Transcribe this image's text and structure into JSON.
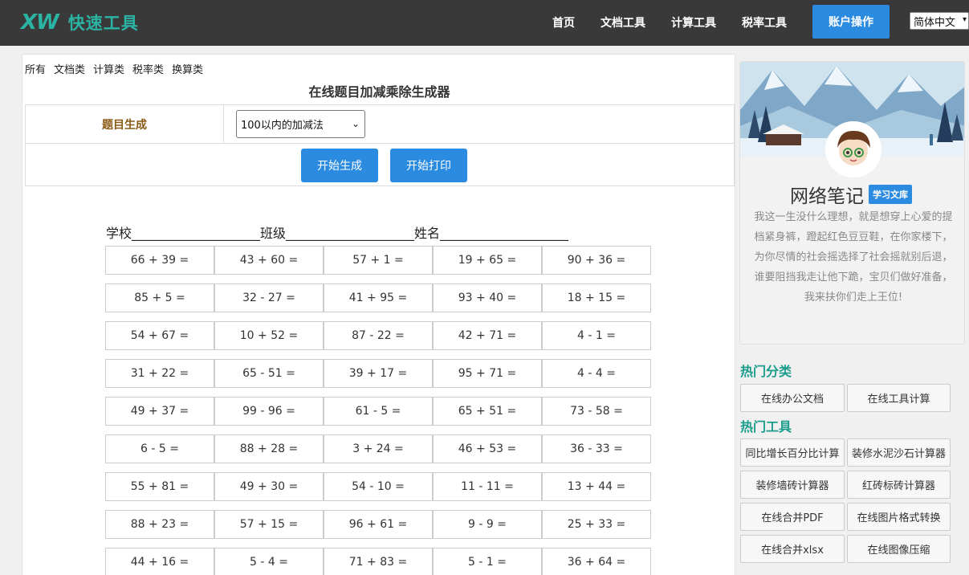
{
  "header": {
    "logo_mark": "XW",
    "logo_text": "快速工具",
    "nav": [
      "首页",
      "文档工具",
      "计算工具",
      "税率工具"
    ],
    "account_button": "账户操作",
    "language": "简体中文"
  },
  "main": {
    "categories": [
      "所有",
      "文档类",
      "计算类",
      "税率类",
      "换算类"
    ],
    "title": "在线题目加减乘除生成器",
    "form": {
      "label": "题目生成",
      "select_value": "100以内的加减法",
      "generate_button": "开始生成",
      "print_button": "开始打印"
    },
    "sheet_header": "学校____________________班级____________________姓名____________________",
    "problems": [
      [
        "66 + 39 =",
        "43 + 60 =",
        "57 + 1 =",
        "19 + 65 =",
        "90 + 36 ="
      ],
      [
        "85 + 5 =",
        "32 - 27 =",
        "41 + 95 =",
        "93 + 40 =",
        "18 + 15 ="
      ],
      [
        "54 + 67 =",
        "10 + 52 =",
        "87 - 22 =",
        "42 + 71 =",
        "4 - 1 ="
      ],
      [
        "31 + 22 =",
        "65 - 51 =",
        "39 + 17 =",
        "95 + 71 =",
        "4 - 4 ="
      ],
      [
        "49 + 37 =",
        "99 - 96 =",
        "61 - 5 =",
        "65 + 51 =",
        "73 - 58 ="
      ],
      [
        "6 - 5 =",
        "88 + 28 =",
        "3 + 24 =",
        "46 + 53 =",
        "36 - 33 ="
      ],
      [
        "55 + 81 =",
        "49 + 30 =",
        "54 - 10 =",
        "11 - 11 =",
        "13 + 44 ="
      ],
      [
        "88 + 23 =",
        "57 + 15 =",
        "96 + 61 =",
        "9 - 9 =",
        "25 + 33 ="
      ],
      [
        "44 + 16 =",
        "5 - 4 =",
        "71 + 83 =",
        "5 - 1 =",
        "36 + 64 ="
      ]
    ]
  },
  "sidebar": {
    "profile_name": "网络笔记",
    "profile_badge": "学习文库",
    "bio": "我这一生没什么理想，就是想穿上心爱的提档紧身裤，蹬起红色豆豆鞋，在你家楼下，为你尽情的社会摇选择了社会摇就别后退，谁要阻挡我走让他下跪，宝贝们做好准备，我来扶你们走上王位!",
    "hot_categories_title": "热门分类",
    "hot_categories": [
      "在线办公文档",
      "在线工具计算"
    ],
    "hot_tools_title": "热门工具",
    "hot_tools": [
      "同比增长百分比计算",
      "装修水泥沙石计算器",
      "装修墙砖计算器",
      "红砖标砖计算器",
      "在线合并PDF",
      "在线图片格式转换",
      "在线合并xlsx",
      "在线图像压缩"
    ]
  },
  "colors": {
    "header_bg": "#393939",
    "accent_teal": "#1a9c8c",
    "button_blue": "#2a8be0",
    "label_brown": "#8a5a14"
  }
}
